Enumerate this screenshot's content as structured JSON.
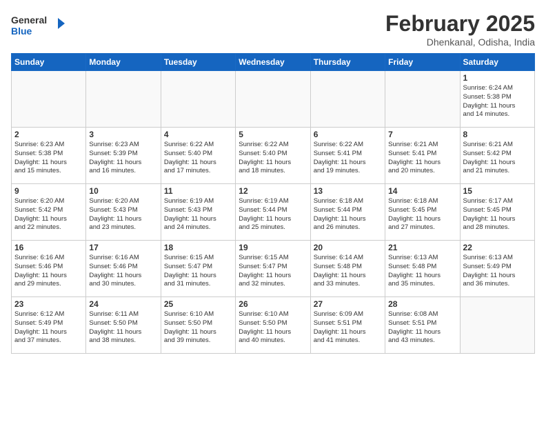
{
  "header": {
    "logo_line1": "General",
    "logo_line2": "Blue",
    "month_title": "February 2025",
    "location": "Dhenkanal, Odisha, India"
  },
  "weekdays": [
    "Sunday",
    "Monday",
    "Tuesday",
    "Wednesday",
    "Thursday",
    "Friday",
    "Saturday"
  ],
  "weeks": [
    [
      {
        "day": "",
        "info": ""
      },
      {
        "day": "",
        "info": ""
      },
      {
        "day": "",
        "info": ""
      },
      {
        "day": "",
        "info": ""
      },
      {
        "day": "",
        "info": ""
      },
      {
        "day": "",
        "info": ""
      },
      {
        "day": "1",
        "info": "Sunrise: 6:24 AM\nSunset: 5:38 PM\nDaylight: 11 hours\nand 14 minutes."
      }
    ],
    [
      {
        "day": "2",
        "info": "Sunrise: 6:23 AM\nSunset: 5:38 PM\nDaylight: 11 hours\nand 15 minutes."
      },
      {
        "day": "3",
        "info": "Sunrise: 6:23 AM\nSunset: 5:39 PM\nDaylight: 11 hours\nand 16 minutes."
      },
      {
        "day": "4",
        "info": "Sunrise: 6:22 AM\nSunset: 5:40 PM\nDaylight: 11 hours\nand 17 minutes."
      },
      {
        "day": "5",
        "info": "Sunrise: 6:22 AM\nSunset: 5:40 PM\nDaylight: 11 hours\nand 18 minutes."
      },
      {
        "day": "6",
        "info": "Sunrise: 6:22 AM\nSunset: 5:41 PM\nDaylight: 11 hours\nand 19 minutes."
      },
      {
        "day": "7",
        "info": "Sunrise: 6:21 AM\nSunset: 5:41 PM\nDaylight: 11 hours\nand 20 minutes."
      },
      {
        "day": "8",
        "info": "Sunrise: 6:21 AM\nSunset: 5:42 PM\nDaylight: 11 hours\nand 21 minutes."
      }
    ],
    [
      {
        "day": "9",
        "info": "Sunrise: 6:20 AM\nSunset: 5:42 PM\nDaylight: 11 hours\nand 22 minutes."
      },
      {
        "day": "10",
        "info": "Sunrise: 6:20 AM\nSunset: 5:43 PM\nDaylight: 11 hours\nand 23 minutes."
      },
      {
        "day": "11",
        "info": "Sunrise: 6:19 AM\nSunset: 5:43 PM\nDaylight: 11 hours\nand 24 minutes."
      },
      {
        "day": "12",
        "info": "Sunrise: 6:19 AM\nSunset: 5:44 PM\nDaylight: 11 hours\nand 25 minutes."
      },
      {
        "day": "13",
        "info": "Sunrise: 6:18 AM\nSunset: 5:44 PM\nDaylight: 11 hours\nand 26 minutes."
      },
      {
        "day": "14",
        "info": "Sunrise: 6:18 AM\nSunset: 5:45 PM\nDaylight: 11 hours\nand 27 minutes."
      },
      {
        "day": "15",
        "info": "Sunrise: 6:17 AM\nSunset: 5:45 PM\nDaylight: 11 hours\nand 28 minutes."
      }
    ],
    [
      {
        "day": "16",
        "info": "Sunrise: 6:16 AM\nSunset: 5:46 PM\nDaylight: 11 hours\nand 29 minutes."
      },
      {
        "day": "17",
        "info": "Sunrise: 6:16 AM\nSunset: 5:46 PM\nDaylight: 11 hours\nand 30 minutes."
      },
      {
        "day": "18",
        "info": "Sunrise: 6:15 AM\nSunset: 5:47 PM\nDaylight: 11 hours\nand 31 minutes."
      },
      {
        "day": "19",
        "info": "Sunrise: 6:15 AM\nSunset: 5:47 PM\nDaylight: 11 hours\nand 32 minutes."
      },
      {
        "day": "20",
        "info": "Sunrise: 6:14 AM\nSunset: 5:48 PM\nDaylight: 11 hours\nand 33 minutes."
      },
      {
        "day": "21",
        "info": "Sunrise: 6:13 AM\nSunset: 5:48 PM\nDaylight: 11 hours\nand 35 minutes."
      },
      {
        "day": "22",
        "info": "Sunrise: 6:13 AM\nSunset: 5:49 PM\nDaylight: 11 hours\nand 36 minutes."
      }
    ],
    [
      {
        "day": "23",
        "info": "Sunrise: 6:12 AM\nSunset: 5:49 PM\nDaylight: 11 hours\nand 37 minutes."
      },
      {
        "day": "24",
        "info": "Sunrise: 6:11 AM\nSunset: 5:50 PM\nDaylight: 11 hours\nand 38 minutes."
      },
      {
        "day": "25",
        "info": "Sunrise: 6:10 AM\nSunset: 5:50 PM\nDaylight: 11 hours\nand 39 minutes."
      },
      {
        "day": "26",
        "info": "Sunrise: 6:10 AM\nSunset: 5:50 PM\nDaylight: 11 hours\nand 40 minutes."
      },
      {
        "day": "27",
        "info": "Sunrise: 6:09 AM\nSunset: 5:51 PM\nDaylight: 11 hours\nand 41 minutes."
      },
      {
        "day": "28",
        "info": "Sunrise: 6:08 AM\nSunset: 5:51 PM\nDaylight: 11 hours\nand 43 minutes."
      },
      {
        "day": "",
        "info": ""
      }
    ]
  ]
}
